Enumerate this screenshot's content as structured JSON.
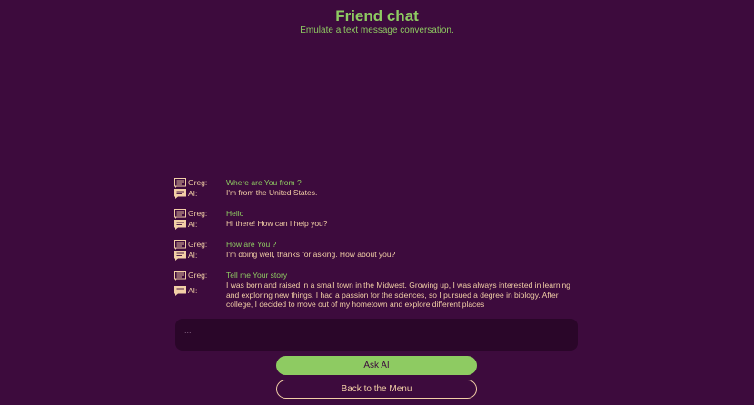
{
  "header": {
    "title": "Friend chat",
    "subtitle": "Emulate a text message conversation."
  },
  "chat": {
    "exchanges": [
      {
        "user_label": "Greg:",
        "user_text": "Where are You from ?",
        "ai_label": "AI:",
        "ai_text": "I'm from the United States."
      },
      {
        "user_label": "Greg:",
        "user_text": "Hello",
        "ai_label": "AI:",
        "ai_text": "Hi there! How can I help you?"
      },
      {
        "user_label": "Greg:",
        "user_text": "How are You ?",
        "ai_label": "AI:",
        "ai_text": "I'm doing well, thanks for asking. How about you?"
      },
      {
        "user_label": "Greg:",
        "user_text": "Tell me Your story",
        "ai_label": "AI:",
        "ai_text": "I was born and raised in a small town in the Midwest. Growing up, I was always interested in learning and exploring new things. I had a passion for the sciences, so I pursued a degree in biology. After college, I decided to move out of my hometown and explore different places"
      }
    ]
  },
  "input": {
    "value": "..."
  },
  "buttons": {
    "ask_label": "Ask AI",
    "menu_label": "Back to the Menu"
  },
  "colors": {
    "background": "#3d0b3d",
    "accent": "#8ecb62",
    "text": "#f2cfa6"
  },
  "icons": {
    "user": "chat-lines-icon",
    "ai": "chat-bubble-icon"
  }
}
